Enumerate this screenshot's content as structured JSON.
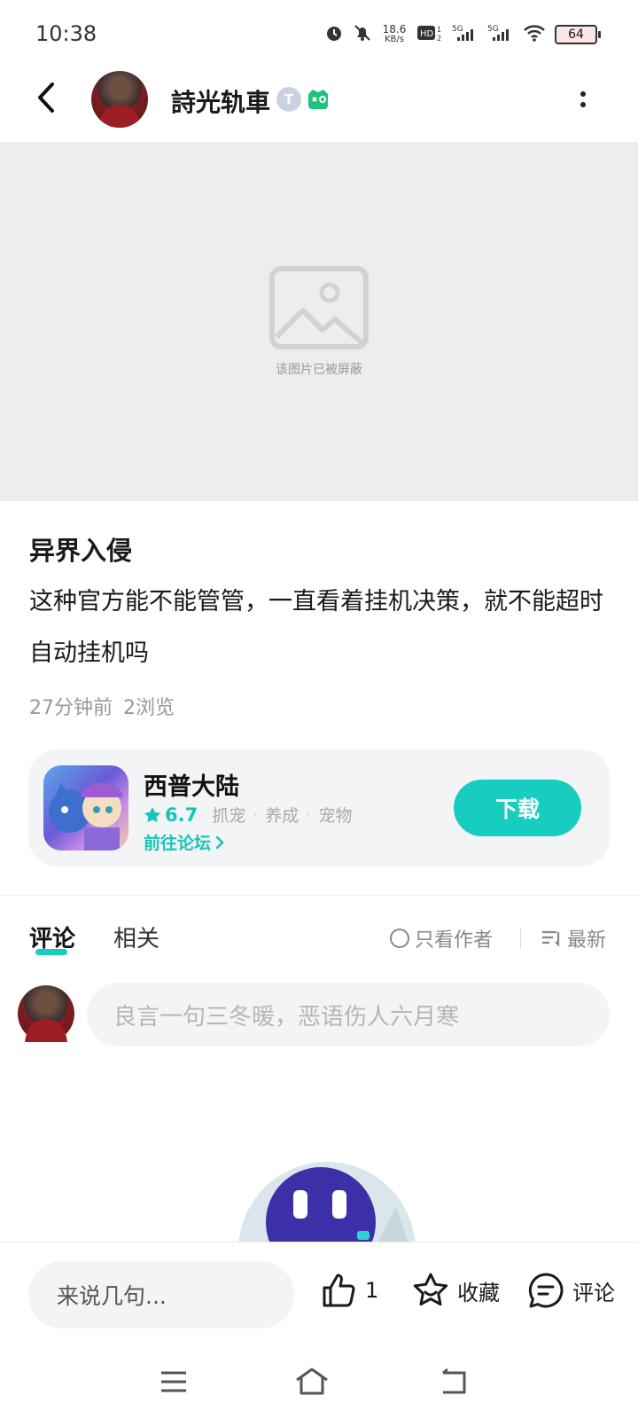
{
  "status_bar": {
    "time": "10:38",
    "net_speed_value": "18.6",
    "net_speed_unit": "KB/s",
    "battery": "64"
  },
  "header": {
    "username": "詩光轨車",
    "badge_t": "T"
  },
  "media": {
    "blocked_text": "该图片已被屏蔽"
  },
  "post": {
    "title": "异界入侵",
    "content": "这种官方能不能管管，一直看着挂机决策，就不能超时自动挂机吗",
    "time_ago": "27分钟前",
    "views": "2浏览"
  },
  "game_card": {
    "name": "西普大陆",
    "rating": "6.7",
    "tags": [
      "抓宠",
      "养成",
      "宠物"
    ],
    "forum_link": "前往论坛",
    "download_label": "下载"
  },
  "tabs": {
    "comments": "评论",
    "related": "相关",
    "author_only": "只看作者",
    "sort": "最新"
  },
  "comment_input": {
    "placeholder": "良言一句三冬暖，恶语伤人六月寒"
  },
  "action_bar": {
    "input_placeholder": "来说几句...",
    "like_count": "1",
    "favorite_label": "收藏",
    "comment_label": "评论"
  },
  "colors": {
    "accent": "#17cdbf",
    "placeholder_bg": "#ededed",
    "card_bg": "#f3f4f6"
  }
}
